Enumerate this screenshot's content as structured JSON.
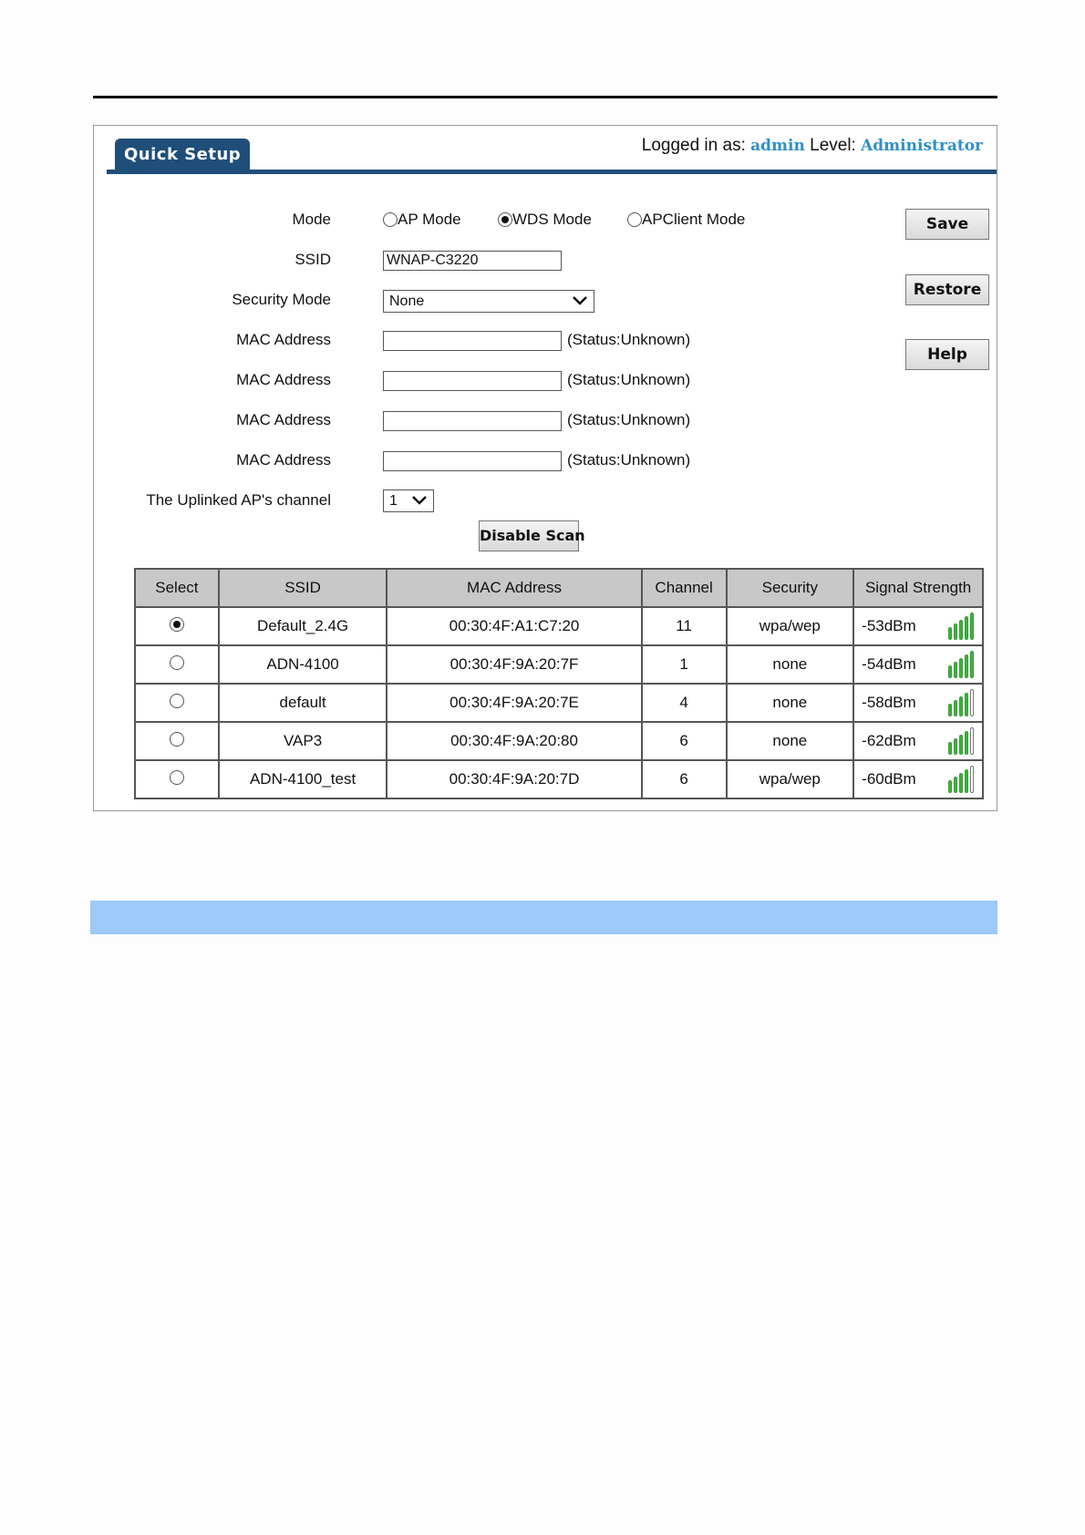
{
  "header": {
    "tab_label": "Quick Setup",
    "logged_in_prefix": "Logged in as:",
    "user": "admin",
    "level_prefix": "Level:",
    "level": "Administrator"
  },
  "form": {
    "mode_label": "Mode",
    "mode_options": [
      "AP Mode",
      "WDS Mode",
      "APClient Mode"
    ],
    "mode_selected": "WDS Mode",
    "ssid_label": "SSID",
    "ssid_value": "WNAP-C3220",
    "security_label": "Security Mode",
    "security_value": "None",
    "mac_label": "MAC Address",
    "mac_status": "(Status:Unknown)",
    "channel_label": "The Uplinked AP's channel",
    "channel_value": "1",
    "disable_scan": "Disable Scan"
  },
  "buttons": {
    "save": "Save",
    "restore": "Restore",
    "help": "Help"
  },
  "table": {
    "headers": [
      "Select",
      "SSID",
      "MAC Address",
      "Channel",
      "Security",
      "Signal Strength"
    ],
    "rows": [
      {
        "selected": true,
        "ssid": "Default_2.4G",
        "mac": "00:30:4F:A1:C7:20",
        "channel": "11",
        "security": "wpa/wep",
        "signal": "-53dBm",
        "bars": 5
      },
      {
        "selected": false,
        "ssid": "ADN-4100",
        "mac": "00:30:4F:9A:20:7F",
        "channel": "1",
        "security": "none",
        "signal": "-54dBm",
        "bars": 5
      },
      {
        "selected": false,
        "ssid": "default",
        "mac": "00:30:4F:9A:20:7E",
        "channel": "4",
        "security": "none",
        "signal": "-58dBm",
        "bars": 4
      },
      {
        "selected": false,
        "ssid": "VAP3",
        "mac": "00:30:4F:9A:20:80",
        "channel": "6",
        "security": "none",
        "signal": "-62dBm",
        "bars": 4
      },
      {
        "selected": false,
        "ssid": "ADN-4100_test",
        "mac": "00:30:4F:9A:20:7D",
        "channel": "6",
        "security": "wpa/wep",
        "signal": "-60dBm",
        "bars": 4
      }
    ]
  },
  "colors": {
    "tab_bg": "#1f4e79",
    "user_text": "#2f8fc7",
    "band": "#9ccaf9",
    "signal_on": "#3cb43c"
  }
}
